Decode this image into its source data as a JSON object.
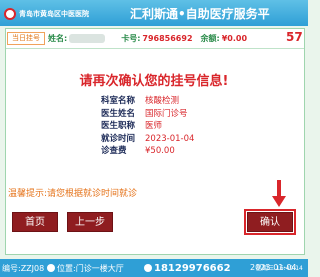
{
  "header": {
    "logo_text": "青岛市黄岛区中医医院",
    "title": "汇利斯通•自助医疗服务平"
  },
  "tab_label": "当日挂号",
  "patient_bar": {
    "name_label": "姓名:",
    "card_label": "卡号:",
    "card_value": "796856692",
    "balance_label": "余额:",
    "balance_value": "¥0.00"
  },
  "countdown": "57",
  "main_title": "请再次确认您的挂号信息!",
  "details": [
    {
      "label": "科室名称",
      "value": "核酸检测"
    },
    {
      "label": "医生姓名",
      "value": "国际门诊号"
    },
    {
      "label": "医生职称",
      "value": "医师"
    },
    {
      "label": "就诊时间",
      "value": "2023-01-04"
    },
    {
      "label": "诊查费",
      "value": "¥50.00"
    }
  ],
  "tip": "温馨提示:请您根据就诊时间就诊",
  "buttons": {
    "home": "首页",
    "prev": "上一步",
    "confirm": "确认"
  },
  "footer": {
    "terminal": "编号:ZZJ08",
    "location": "位置:门诊一楼大厅",
    "phone": "18129976662",
    "date": "2023-01-04",
    "time": "星期三 16:49:14"
  },
  "colors": {
    "accent_red": "#d9262b",
    "button_bg": "#8f1d20",
    "header_blue": "#2f9fd6"
  }
}
